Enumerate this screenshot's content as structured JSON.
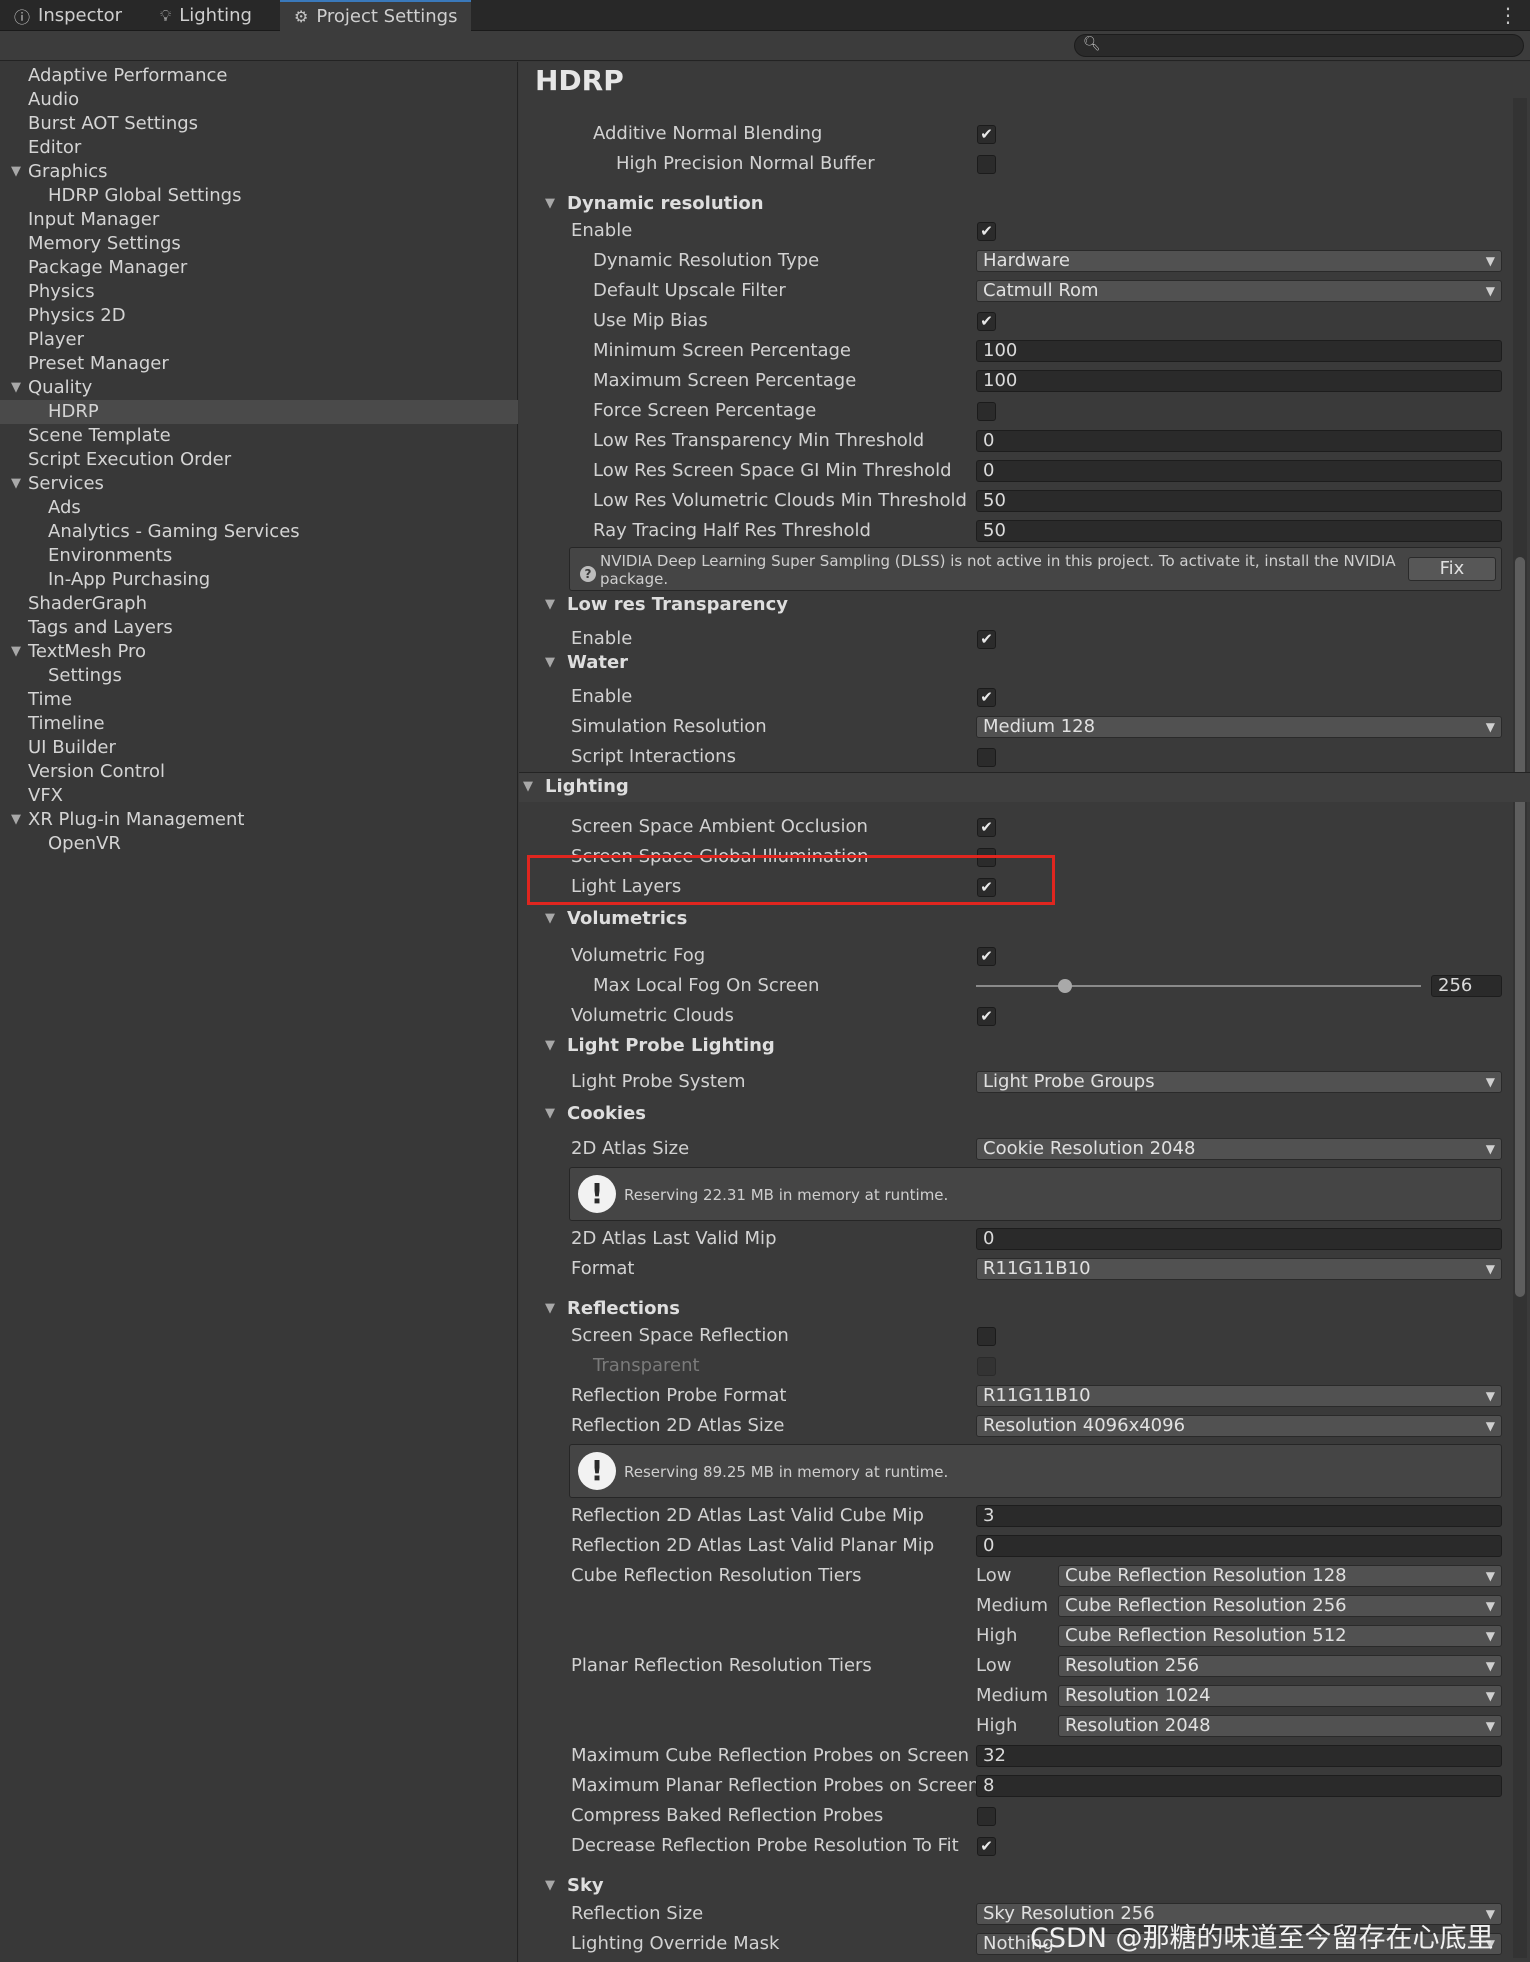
{
  "tabs": [
    {
      "label": "Inspector",
      "icon": "info-icon"
    },
    {
      "label": "Lighting",
      "icon": "bulb-icon"
    },
    {
      "label": "Project Settings",
      "icon": "gear-icon"
    }
  ],
  "search": {
    "value": ""
  },
  "sidebar": {
    "items": [
      {
        "label": "Adaptive Performance"
      },
      {
        "label": "Audio"
      },
      {
        "label": "Burst AOT Settings"
      },
      {
        "label": "Editor"
      },
      {
        "label": "Graphics",
        "expanded": true
      },
      {
        "label": "HDRP Global Settings",
        "indent": 1
      },
      {
        "label": "Input Manager"
      },
      {
        "label": "Memory Settings"
      },
      {
        "label": "Package Manager"
      },
      {
        "label": "Physics"
      },
      {
        "label": "Physics 2D"
      },
      {
        "label": "Player"
      },
      {
        "label": "Preset Manager"
      },
      {
        "label": "Quality",
        "expanded": true
      },
      {
        "label": "HDRP",
        "indent": 1,
        "selected": true
      },
      {
        "label": "Scene Template"
      },
      {
        "label": "Script Execution Order"
      },
      {
        "label": "Services",
        "expanded": true
      },
      {
        "label": "Ads",
        "indent": 1
      },
      {
        "label": "Analytics - Gaming Services",
        "indent": 1
      },
      {
        "label": "Environments",
        "indent": 1
      },
      {
        "label": "In-App Purchasing",
        "indent": 1
      },
      {
        "label": "ShaderGraph"
      },
      {
        "label": "Tags and Layers"
      },
      {
        "label": "TextMesh Pro",
        "expanded": true
      },
      {
        "label": "Settings",
        "indent": 1
      },
      {
        "label": "Time"
      },
      {
        "label": "Timeline"
      },
      {
        "label": "UI Builder"
      },
      {
        "label": "Version Control"
      },
      {
        "label": "VFX"
      },
      {
        "label": "XR Plug-in Management",
        "expanded": true
      },
      {
        "label": "OpenVR",
        "indent": 1
      }
    ]
  },
  "main": {
    "title": "HDRP",
    "rows": [
      {
        "kind": "check",
        "label": "Additive Normal Blending",
        "level": 2,
        "checked": true
      },
      {
        "kind": "check",
        "label": "High Precision Normal Buffer",
        "level": 3,
        "checked": false
      },
      {
        "kind": "header",
        "label": "Dynamic resolution"
      },
      {
        "kind": "check",
        "label": "Enable",
        "level": 1,
        "checked": true
      },
      {
        "kind": "dropdown",
        "label": "Dynamic Resolution Type",
        "level": 2,
        "value": "Hardware"
      },
      {
        "kind": "dropdown",
        "label": "Default Upscale Filter",
        "level": 2,
        "value": "Catmull Rom"
      },
      {
        "kind": "check",
        "label": "Use Mip Bias",
        "level": 2,
        "checked": true
      },
      {
        "kind": "field",
        "label": "Minimum Screen Percentage",
        "level": 2,
        "value": "100"
      },
      {
        "kind": "field",
        "label": "Maximum Screen Percentage",
        "level": 2,
        "value": "100"
      },
      {
        "kind": "check",
        "label": "Force Screen Percentage",
        "level": 2,
        "checked": false
      },
      {
        "kind": "field",
        "label": "Low Res Transparency Min Threshold",
        "level": 2,
        "value": "0"
      },
      {
        "kind": "field",
        "label": "Low Res Screen Space GI Min Threshold",
        "level": 2,
        "value": "0"
      },
      {
        "kind": "field",
        "label": "Low Res Volumetric Clouds Min Threshold",
        "level": 2,
        "value": "50"
      },
      {
        "kind": "field",
        "label": "Ray Tracing Half Res Threshold",
        "level": 2,
        "value": "50"
      },
      {
        "kind": "help-fix",
        "text": "NVIDIA Deep Learning Super Sampling (DLSS) is not active in this project. To activate it, install the NVIDIA package.",
        "button": "Fix"
      },
      {
        "kind": "header",
        "label": "Low res Transparency"
      },
      {
        "kind": "check",
        "label": "Enable",
        "level": 1,
        "checked": true
      },
      {
        "kind": "header",
        "label": "Water"
      },
      {
        "kind": "check",
        "label": "Enable",
        "level": 1,
        "checked": true
      },
      {
        "kind": "dropdown",
        "label": "Simulation Resolution",
        "level": 1,
        "value": "Medium 128"
      },
      {
        "kind": "check",
        "label": "Script Interactions",
        "level": 1,
        "checked": false
      },
      {
        "kind": "topsection",
        "label": "Lighting"
      },
      {
        "kind": "check",
        "label": "Screen Space Ambient Occlusion",
        "level": 1,
        "checked": true
      },
      {
        "kind": "check",
        "label": "Screen Space Global Illumination",
        "level": 1,
        "checked": false
      },
      {
        "kind": "check",
        "label": "Light Layers",
        "level": 1,
        "checked": true
      },
      {
        "kind": "header",
        "label": "Volumetrics"
      },
      {
        "kind": "check",
        "label": "Volumetric Fog",
        "level": 1,
        "checked": true
      },
      {
        "kind": "slider",
        "label": "Max Local Fog On Screen",
        "level": 2,
        "value": "256",
        "fraction": 0.2
      },
      {
        "kind": "check",
        "label": "Volumetric Clouds",
        "level": 1,
        "checked": true
      },
      {
        "kind": "header",
        "label": "Light Probe Lighting"
      },
      {
        "kind": "dropdown",
        "label": "Light Probe System",
        "level": 1,
        "value": "Light Probe Groups"
      },
      {
        "kind": "header",
        "label": "Cookies"
      },
      {
        "kind": "dropdown",
        "label": "2D Atlas Size",
        "level": 1,
        "value": "Cookie Resolution 2048"
      },
      {
        "kind": "help-warn",
        "text": "Reserving 22.31 MB in memory at runtime."
      },
      {
        "kind": "field",
        "label": "2D Atlas Last Valid Mip",
        "level": 1,
        "value": "0"
      },
      {
        "kind": "dropdown",
        "label": "Format",
        "level": 1,
        "value": "R11G11B10"
      },
      {
        "kind": "header",
        "label": "Reflections"
      },
      {
        "kind": "check",
        "label": "Screen Space Reflection",
        "level": 1,
        "checked": false
      },
      {
        "kind": "check",
        "label": "Transparent",
        "level": 2,
        "checked": false,
        "disabled": true
      },
      {
        "kind": "dropdown",
        "label": "Reflection Probe Format",
        "level": 1,
        "value": "R11G11B10"
      },
      {
        "kind": "dropdown",
        "label": "Reflection 2D Atlas Size",
        "level": 1,
        "value": "Resolution 4096x4096"
      },
      {
        "kind": "help-warn",
        "text": "Reserving 89.25 MB in memory at runtime."
      },
      {
        "kind": "field",
        "label": "Reflection 2D Atlas Last Valid Cube Mip",
        "level": 1,
        "value": "3"
      },
      {
        "kind": "field",
        "label": "Reflection 2D Atlas Last Valid Planar Mip",
        "level": 1,
        "value": "0"
      },
      {
        "kind": "tier",
        "label": "Cube Reflection Resolution Tiers",
        "level": 1,
        "tier": "Low",
        "value": "Cube Reflection Resolution 128"
      },
      {
        "kind": "tier",
        "label": "",
        "level": 1,
        "tier": "Medium",
        "value": "Cube Reflection Resolution 256"
      },
      {
        "kind": "tier",
        "label": "",
        "level": 1,
        "tier": "High",
        "value": "Cube Reflection Resolution 512"
      },
      {
        "kind": "tier",
        "label": "Planar Reflection Resolution Tiers",
        "level": 1,
        "tier": "Low",
        "value": "Resolution 256"
      },
      {
        "kind": "tier",
        "label": "",
        "level": 1,
        "tier": "Medium",
        "value": "Resolution 1024"
      },
      {
        "kind": "tier",
        "label": "",
        "level": 1,
        "tier": "High",
        "value": "Resolution 2048"
      },
      {
        "kind": "field",
        "label": "Maximum Cube Reflection Probes on Screen",
        "level": 1,
        "value": "32"
      },
      {
        "kind": "field",
        "label": "Maximum Planar Reflection Probes on Screen",
        "level": 1,
        "value": "8"
      },
      {
        "kind": "check",
        "label": "Compress Baked Reflection Probes",
        "level": 1,
        "checked": false
      },
      {
        "kind": "check",
        "label": "Decrease Reflection Probe Resolution To Fit",
        "level": 1,
        "checked": true
      },
      {
        "kind": "header",
        "label": "Sky"
      },
      {
        "kind": "dropdown",
        "label": "Reflection Size",
        "level": 1,
        "value": "Sky Resolution 256"
      },
      {
        "kind": "dropdown",
        "label": "Lighting Override Mask",
        "level": 1,
        "value": "Nothing"
      }
    ]
  },
  "watermark": "CSDN @那糖的味道至今留存在心底里",
  "colors": {
    "highlight": "#e0261f",
    "accent": "#3a79bb"
  }
}
